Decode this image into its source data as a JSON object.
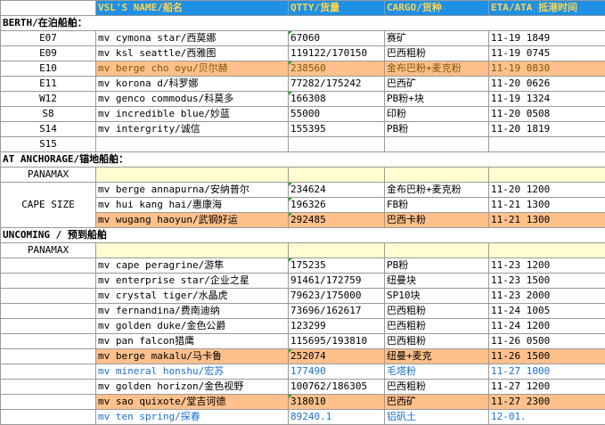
{
  "columns": [
    "",
    "VSL'S NAME/船名",
    "QTTY/货量",
    "CARGO/货种",
    "ETA/ATA 抵港时间"
  ],
  "berth": {
    "title": "BERTH/在泊船舶：",
    "rows": [
      {
        "berth": "E07",
        "vessel": "mv cymona star/西莫娜",
        "qtty": "67060",
        "cargo": "赛矿",
        "eta": "11-19 1849"
      },
      {
        "berth": "E09",
        "vessel": "mv ksl seattle/西雅图",
        "qtty": "119122/170150",
        "cargo": "巴西粗粉",
        "eta": "11-19 0745"
      },
      {
        "berth": "E10",
        "vessel": "mv berge cho oyu/贝尔赫",
        "qtty": "238560",
        "cargo": "金布巴粉+麦克粉",
        "eta": "11-19 0830"
      },
      {
        "berth": "E11",
        "vessel": "mv korona d/科罗娜",
        "qtty": "77282/175242",
        "cargo": "巴西矿",
        "eta": "11-20 0626"
      },
      {
        "berth": "W12",
        "vessel": "mv genco commodus/科莫多",
        "qtty": "166308",
        "cargo": "PB粉+块",
        "eta": "11-19 1324"
      },
      {
        "berth": "S8",
        "vessel": "mv incredible blue/妙蓝",
        "qtty": "55000",
        "cargo": "印粉",
        "eta": "11-20 0508"
      },
      {
        "berth": "S14",
        "vessel": "mv intergrity/诚信",
        "qtty": "155395",
        "cargo": "PB粉",
        "eta": "11-20 1819"
      },
      {
        "berth": "S15",
        "vessel": "",
        "qtty": "",
        "cargo": "",
        "eta": ""
      }
    ]
  },
  "anchorage": {
    "title": "AT ANCHORAGE/锚地船舶：",
    "panamax": "PANAMAX",
    "cape": "CAPE SIZE",
    "rows": [
      {
        "vessel": "mv berge annapurna/安纳普尔",
        "qtty": "234624",
        "cargo": "金布巴粉+麦克粉",
        "eta": "11-20 1200"
      },
      {
        "vessel": "mv hui kang hai/惠康海",
        "qtty": "196326",
        "cargo": "FB粉",
        "eta": "11-21 1300"
      },
      {
        "vessel": "mv wugang haoyun/武钢好运",
        "qtty": "292485",
        "cargo": "巴西卡粉",
        "eta": "11-21 1300"
      }
    ]
  },
  "upcoming": {
    "title": "UNCOMING / 预到船舶",
    "panamax": "PANAMAX",
    "rows": [
      {
        "vessel": "mv cape peragrine/游隼",
        "qtty": "175235",
        "cargo": "PB粉",
        "eta": "11-23 1200"
      },
      {
        "vessel": "mv enterprise star/企业之星",
        "qtty": "91461/172759",
        "cargo": "纽曼块",
        "eta": "11-23 1500"
      },
      {
        "vessel": "mv crystal tiger/水晶虎",
        "qtty": "79623/175000",
        "cargo": "SP10块",
        "eta": "11-23 2000"
      },
      {
        "vessel": "mv fernandina/费南迪纳",
        "qtty": "73696/162617",
        "cargo": "巴西粗粉",
        "eta": "11-24 1005"
      },
      {
        "vessel": "mv golden duke/金色公爵",
        "qtty": "123299",
        "cargo": "巴西粗粉",
        "eta": "11-24 1200"
      },
      {
        "vessel": "mv pan falcon猎鹰",
        "qtty": "115695/193810",
        "cargo": "巴西粗粉",
        "eta": "11-26 0500"
      },
      {
        "vessel": "mv berge makalu/马卡鲁",
        "qtty": "252074",
        "cargo": "纽曼+麦克",
        "eta": "11-26 1500"
      },
      {
        "vessel": "mv mineral honshu/宏苏",
        "qtty": "177490",
        "cargo": "毛塔粉",
        "eta": "11-27 1000"
      },
      {
        "vessel": "mv golden horizon/金色视野",
        "qtty": "100762/186305",
        "cargo": "巴西粗粉",
        "eta": "11-27 1200"
      },
      {
        "vessel": "mv sao quixote/堂吉诃德",
        "qtty": "318010",
        "cargo": "巴西矿",
        "eta": "11-27 2300"
      },
      {
        "vessel": "mv ten spring/探春",
        "qtty": "89240.1",
        "cargo": "铝矾土",
        "eta": "12-01."
      }
    ]
  }
}
